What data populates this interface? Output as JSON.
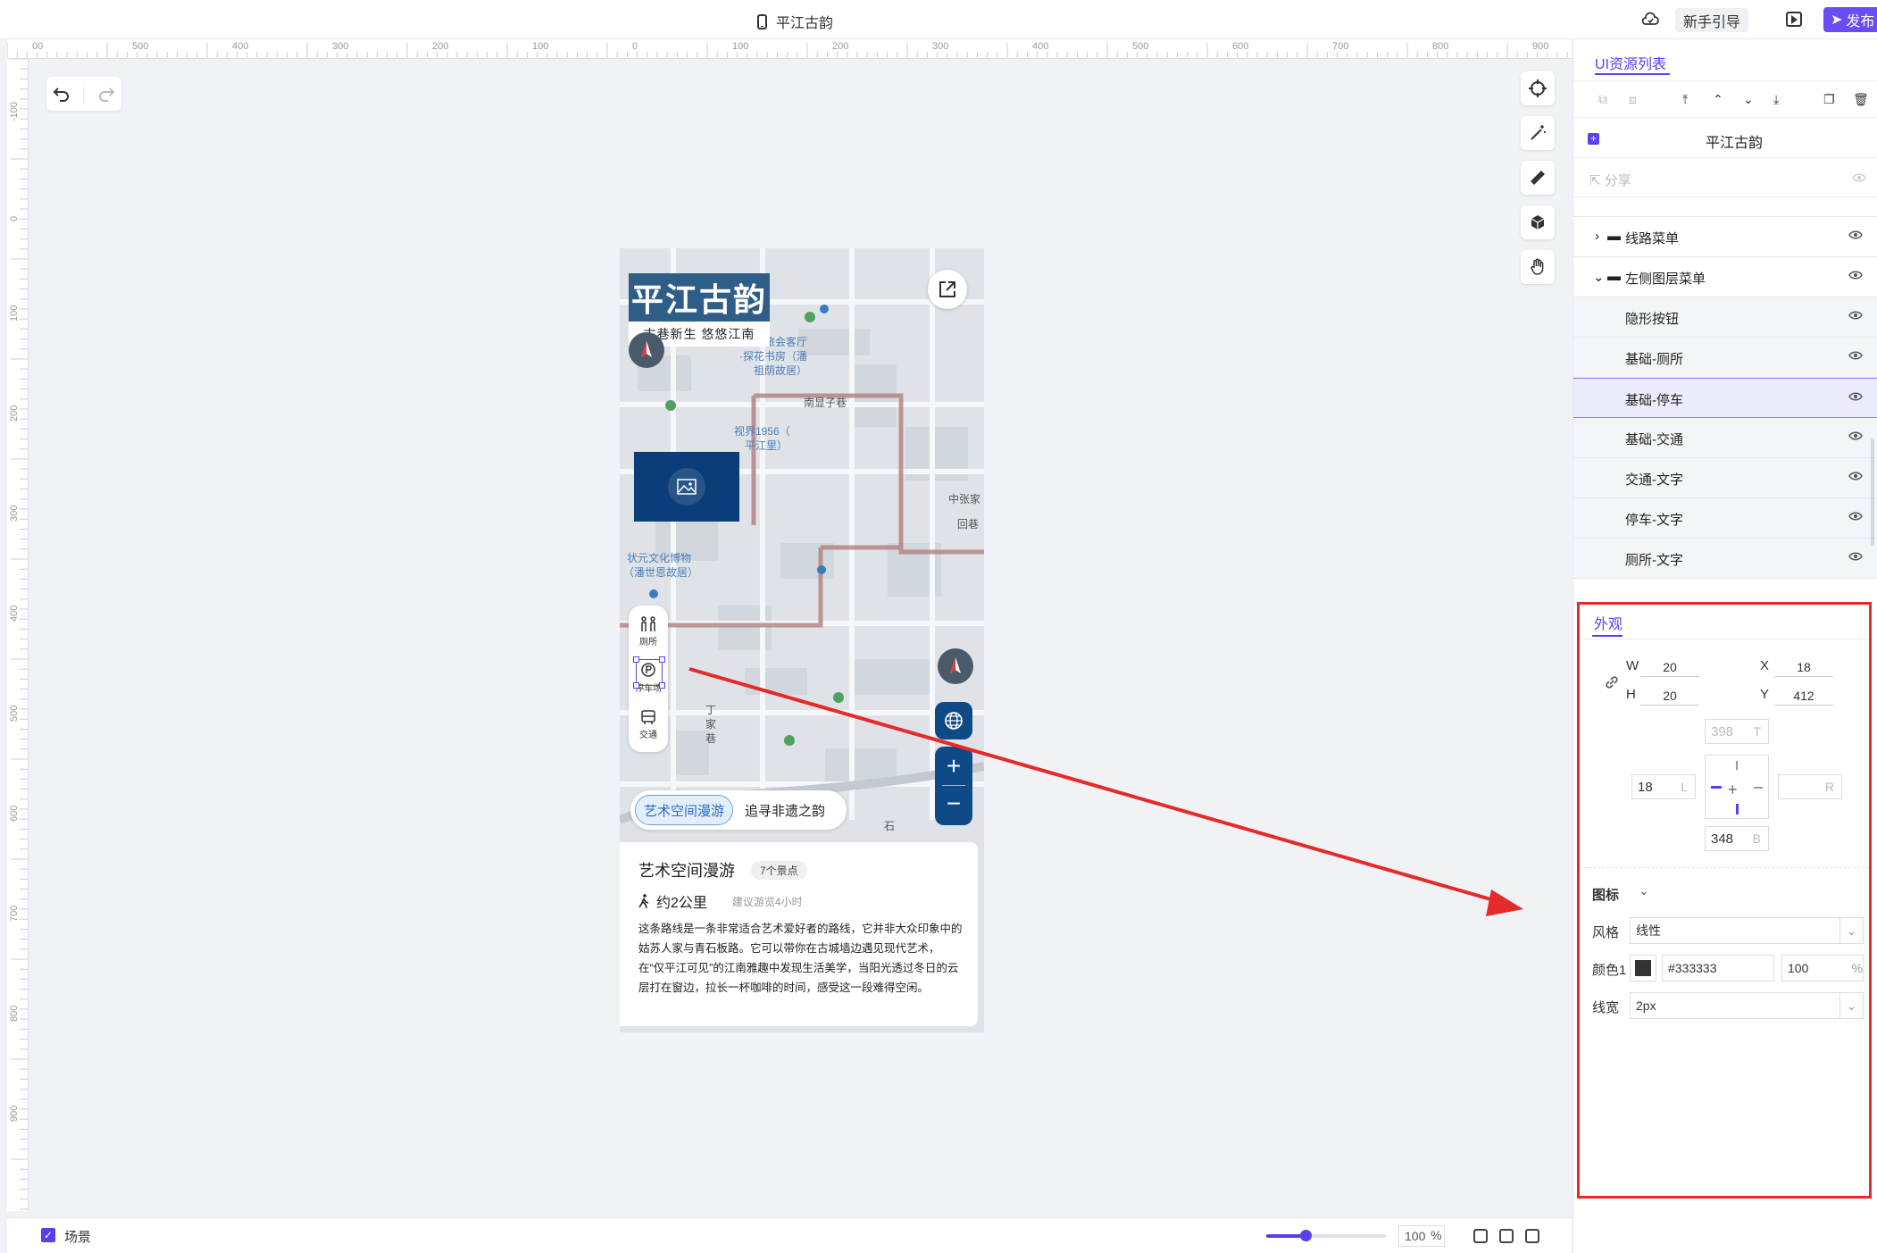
{
  "topbar": {
    "title": "平江古韵",
    "guide_label": "新手引导",
    "publish_label": "发布"
  },
  "ruler": {
    "h_labels": [
      "00",
      "500",
      "400",
      "300",
      "200",
      "100",
      "0",
      "100",
      "200",
      "300",
      "400",
      "500",
      "600",
      "700",
      "800",
      "900"
    ],
    "v_labels": [
      "-100",
      "0",
      "100",
      "200",
      "300",
      "400",
      "500",
      "600",
      "700",
      "800",
      "900"
    ]
  },
  "phone": {
    "brand_title": "平江古韵",
    "brand_sub": "古巷新生 悠悠江南",
    "left_menu": [
      {
        "label": "厕所",
        "icon": "toilet-icon"
      },
      {
        "label": "停车场",
        "icon": "parking-icon"
      },
      {
        "label": "交通",
        "icon": "bus-icon"
      }
    ],
    "route_tabs": [
      "艺术空间漫游",
      "追寻非遗之韵"
    ],
    "map_labels": [
      "苏州文旅会客厅",
      "·探花书房（潘",
      "祖荫故居）",
      "视界1956（",
      "平江里）",
      "状元文化博物",
      "（潘世恩故居）",
      "石",
      "丁",
      "家",
      "巷",
      "南显子巷",
      "中张家",
      "回巷"
    ],
    "card": {
      "title": "艺术空间漫游",
      "badge": "7个景点",
      "distance": "约2公里",
      "hint": "建议游览4小时",
      "description": "这条路线是一条非常适合艺术爱好者的路线，它并非大众印象中的姑苏人家与青石板路。它可以带你在古城墙边遇见现代艺术，在“仅平江可见”的江南雅趣中发现生活美学，当阳光透过冬日的云层打在窗边，拉长一杯咖啡的时间，感受这一段难得空闲。"
    }
  },
  "panel": {
    "tab": "UI资源列表",
    "root_label": "平江古韵",
    "share_label": "分享",
    "layers": [
      {
        "label": "线路菜单",
        "type": "folder",
        "expanded": false
      },
      {
        "label": "左侧图层菜单",
        "type": "folder",
        "expanded": true
      },
      {
        "label": "隐形按钮",
        "type": "child"
      },
      {
        "label": "基础-厕所",
        "type": "child"
      },
      {
        "label": "基础-停车",
        "type": "child",
        "selected": true
      },
      {
        "label": "基础-交通",
        "type": "child"
      },
      {
        "label": "交通-文字",
        "type": "child"
      },
      {
        "label": "停车-文字",
        "type": "child"
      },
      {
        "label": "厕所-文字",
        "type": "child"
      }
    ],
    "appearance": {
      "tab": "外观",
      "w_label": "W",
      "w": "20",
      "h_label": "H",
      "h": "20",
      "x_label": "X",
      "x": "18",
      "y_label": "Y",
      "y": "412",
      "top": "398",
      "top_suf": "T",
      "left": "18",
      "left_suf": "L",
      "right": "",
      "right_suf": "R",
      "bottom": "348",
      "bottom_suf": "B",
      "icon_section": "图标",
      "style_label": "风格",
      "style_value": "线性",
      "color_label": "颜色1",
      "color_hex": "#333333",
      "opacity": "100",
      "opacity_suf": "%",
      "linewidth_label": "线宽",
      "linewidth_value": "2px"
    }
  },
  "bottombar": {
    "scene_label": "场景",
    "zoom": "100",
    "zoom_pct": "%",
    "zoom_level": 0.33
  },
  "colors": {
    "accent": "#5a3ff0",
    "brand": "#2e5d87",
    "highlight": "#e52a2a"
  }
}
